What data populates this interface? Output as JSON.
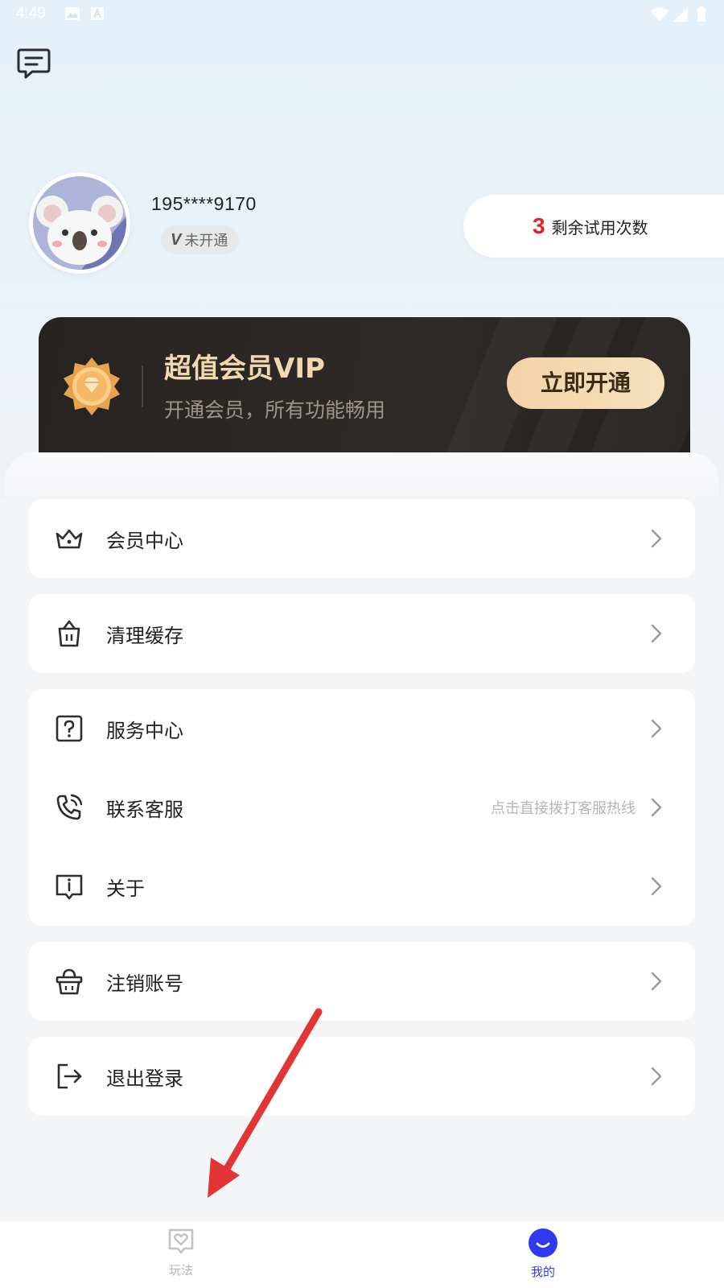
{
  "status_bar": {
    "time": "4:49"
  },
  "profile": {
    "phone": "195****9170",
    "vip_badge_letter": "V",
    "vip_status": "未开通",
    "trial_count": "3",
    "trial_label": "剩余试用次数"
  },
  "vip_card": {
    "title": "超值会员VIP",
    "subtitle": "开通会员，所有功能畅用",
    "button": "立即开通"
  },
  "menu": {
    "member_center": "会员中心",
    "clear_cache": "清理缓存",
    "service_center": "服务中心",
    "contact_service": "联系客服",
    "contact_hint": "点击直接拨打客服热线",
    "about": "关于",
    "delete_account": "注销账号",
    "logout": "退出登录"
  },
  "tabbar": {
    "tabs": [
      {
        "label": "玩法",
        "icon": "heart-card-icon",
        "active": false
      },
      {
        "label": "我的",
        "icon": "smile-icon",
        "active": true
      }
    ]
  },
  "colors": {
    "accent": "#2f3af0",
    "trial_count": "#e32121",
    "vip_gold": "#f3d7ae",
    "annotation_arrow": "#e23636"
  }
}
